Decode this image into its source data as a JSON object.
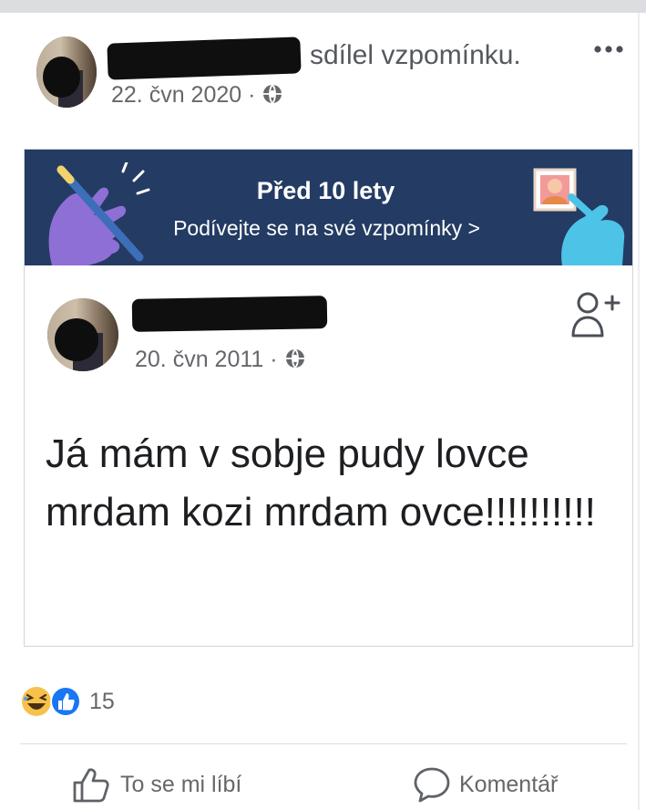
{
  "header": {
    "action_text": "sdílel vzpomínku.",
    "date": "22. čvn 2020 ·"
  },
  "memory_banner": {
    "title": "Před 10 lety",
    "link": "Podívejte se na své vzpomínky >"
  },
  "inner_post": {
    "date": "20. čvn 2011 ·",
    "text": "Já mám v sobje pudy lovce mrdam kozi mrdam ovce!!!!!!!!!!"
  },
  "reactions": {
    "count": "15",
    "types": [
      "haha",
      "like"
    ]
  },
  "actions": {
    "like_label": "To se mi líbí",
    "comment_label": "Komentář"
  },
  "colors": {
    "banner_bg": "#243b63",
    "like_blue": "#1877f2",
    "haha_yellow": "#f7c24b",
    "muted_text": "#65676b"
  },
  "icons": [
    "more-icon",
    "globe-icon",
    "follow-icon",
    "like-icon",
    "comment-icon",
    "haha-reaction-icon",
    "like-reaction-icon"
  ]
}
